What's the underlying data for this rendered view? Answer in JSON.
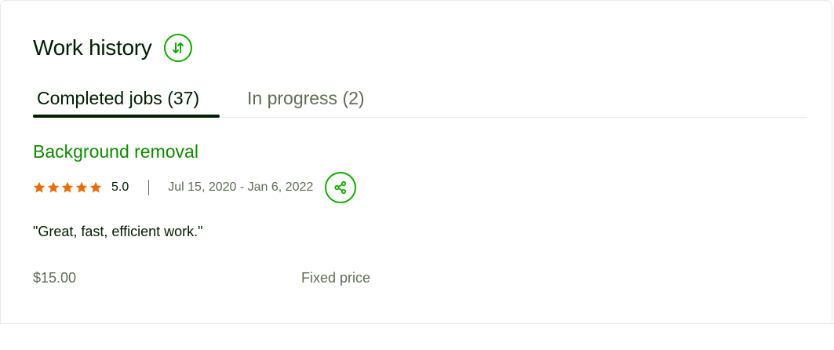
{
  "section": {
    "title": "Work history",
    "sort_icon": "sort-arrows-icon"
  },
  "tabs": [
    {
      "label": "Completed jobs (37)",
      "active": true
    },
    {
      "label": "In progress (2)",
      "active": false
    }
  ],
  "job": {
    "title": "Background removal",
    "rating_stars": 5,
    "rating": "5.0",
    "dates": "Jul 15, 2020 - Jan 6, 2022",
    "share_icon": "share-icon",
    "feedback": "\"Great, fast, efficient work.\"",
    "price": "$15.00",
    "price_type": "Fixed price"
  },
  "colors": {
    "brand_green": "#14a800",
    "link_green": "#108a00",
    "star_orange": "#e86c0a",
    "text_dark": "#001e00",
    "text_muted": "#5e6d55"
  }
}
